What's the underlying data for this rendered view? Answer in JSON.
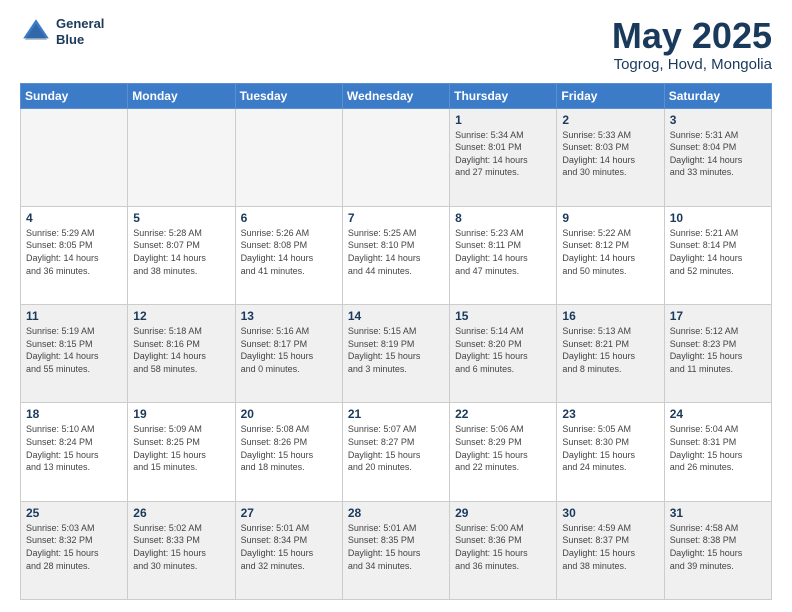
{
  "header": {
    "logo_line1": "General",
    "logo_line2": "Blue",
    "month": "May 2025",
    "location": "Togrog, Hovd, Mongolia"
  },
  "weekdays": [
    "Sunday",
    "Monday",
    "Tuesday",
    "Wednesday",
    "Thursday",
    "Friday",
    "Saturday"
  ],
  "weeks": [
    [
      {
        "day": "",
        "info": "",
        "empty": true
      },
      {
        "day": "",
        "info": "",
        "empty": true
      },
      {
        "day": "",
        "info": "",
        "empty": true
      },
      {
        "day": "",
        "info": "",
        "empty": true
      },
      {
        "day": "1",
        "info": "Sunrise: 5:34 AM\nSunset: 8:01 PM\nDaylight: 14 hours\nand 27 minutes."
      },
      {
        "day": "2",
        "info": "Sunrise: 5:33 AM\nSunset: 8:03 PM\nDaylight: 14 hours\nand 30 minutes."
      },
      {
        "day": "3",
        "info": "Sunrise: 5:31 AM\nSunset: 8:04 PM\nDaylight: 14 hours\nand 33 minutes."
      }
    ],
    [
      {
        "day": "4",
        "info": "Sunrise: 5:29 AM\nSunset: 8:05 PM\nDaylight: 14 hours\nand 36 minutes."
      },
      {
        "day": "5",
        "info": "Sunrise: 5:28 AM\nSunset: 8:07 PM\nDaylight: 14 hours\nand 38 minutes."
      },
      {
        "day": "6",
        "info": "Sunrise: 5:26 AM\nSunset: 8:08 PM\nDaylight: 14 hours\nand 41 minutes."
      },
      {
        "day": "7",
        "info": "Sunrise: 5:25 AM\nSunset: 8:10 PM\nDaylight: 14 hours\nand 44 minutes."
      },
      {
        "day": "8",
        "info": "Sunrise: 5:23 AM\nSunset: 8:11 PM\nDaylight: 14 hours\nand 47 minutes."
      },
      {
        "day": "9",
        "info": "Sunrise: 5:22 AM\nSunset: 8:12 PM\nDaylight: 14 hours\nand 50 minutes."
      },
      {
        "day": "10",
        "info": "Sunrise: 5:21 AM\nSunset: 8:14 PM\nDaylight: 14 hours\nand 52 minutes."
      }
    ],
    [
      {
        "day": "11",
        "info": "Sunrise: 5:19 AM\nSunset: 8:15 PM\nDaylight: 14 hours\nand 55 minutes."
      },
      {
        "day": "12",
        "info": "Sunrise: 5:18 AM\nSunset: 8:16 PM\nDaylight: 14 hours\nand 58 minutes."
      },
      {
        "day": "13",
        "info": "Sunrise: 5:16 AM\nSunset: 8:17 PM\nDaylight: 15 hours\nand 0 minutes."
      },
      {
        "day": "14",
        "info": "Sunrise: 5:15 AM\nSunset: 8:19 PM\nDaylight: 15 hours\nand 3 minutes."
      },
      {
        "day": "15",
        "info": "Sunrise: 5:14 AM\nSunset: 8:20 PM\nDaylight: 15 hours\nand 6 minutes."
      },
      {
        "day": "16",
        "info": "Sunrise: 5:13 AM\nSunset: 8:21 PM\nDaylight: 15 hours\nand 8 minutes."
      },
      {
        "day": "17",
        "info": "Sunrise: 5:12 AM\nSunset: 8:23 PM\nDaylight: 15 hours\nand 11 minutes."
      }
    ],
    [
      {
        "day": "18",
        "info": "Sunrise: 5:10 AM\nSunset: 8:24 PM\nDaylight: 15 hours\nand 13 minutes."
      },
      {
        "day": "19",
        "info": "Sunrise: 5:09 AM\nSunset: 8:25 PM\nDaylight: 15 hours\nand 15 minutes."
      },
      {
        "day": "20",
        "info": "Sunrise: 5:08 AM\nSunset: 8:26 PM\nDaylight: 15 hours\nand 18 minutes."
      },
      {
        "day": "21",
        "info": "Sunrise: 5:07 AM\nSunset: 8:27 PM\nDaylight: 15 hours\nand 20 minutes."
      },
      {
        "day": "22",
        "info": "Sunrise: 5:06 AM\nSunset: 8:29 PM\nDaylight: 15 hours\nand 22 minutes."
      },
      {
        "day": "23",
        "info": "Sunrise: 5:05 AM\nSunset: 8:30 PM\nDaylight: 15 hours\nand 24 minutes."
      },
      {
        "day": "24",
        "info": "Sunrise: 5:04 AM\nSunset: 8:31 PM\nDaylight: 15 hours\nand 26 minutes."
      }
    ],
    [
      {
        "day": "25",
        "info": "Sunrise: 5:03 AM\nSunset: 8:32 PM\nDaylight: 15 hours\nand 28 minutes."
      },
      {
        "day": "26",
        "info": "Sunrise: 5:02 AM\nSunset: 8:33 PM\nDaylight: 15 hours\nand 30 minutes."
      },
      {
        "day": "27",
        "info": "Sunrise: 5:01 AM\nSunset: 8:34 PM\nDaylight: 15 hours\nand 32 minutes."
      },
      {
        "day": "28",
        "info": "Sunrise: 5:01 AM\nSunset: 8:35 PM\nDaylight: 15 hours\nand 34 minutes."
      },
      {
        "day": "29",
        "info": "Sunrise: 5:00 AM\nSunset: 8:36 PM\nDaylight: 15 hours\nand 36 minutes."
      },
      {
        "day": "30",
        "info": "Sunrise: 4:59 AM\nSunset: 8:37 PM\nDaylight: 15 hours\nand 38 minutes."
      },
      {
        "day": "31",
        "info": "Sunrise: 4:58 AM\nSunset: 8:38 PM\nDaylight: 15 hours\nand 39 minutes."
      }
    ]
  ]
}
